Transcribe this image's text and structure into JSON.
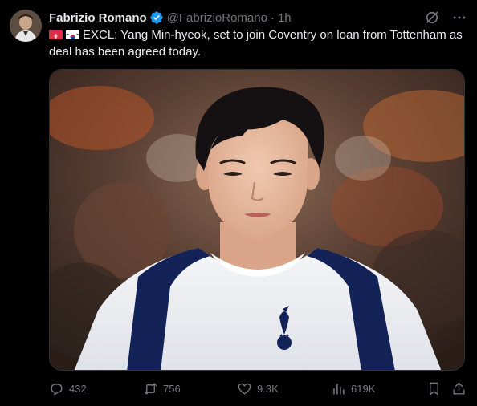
{
  "tweet": {
    "author_name": "Fabrizio Romano",
    "handle": "@FabrizioRomano",
    "separator": "·",
    "time": "1h",
    "text": "EXCL: Yang Min-hyeok, set to join Coventry on loan from Tottenham as deal has been agreed today."
  },
  "icons": {
    "verified": "verified-badge-icon",
    "grok": "grok-icon",
    "more": "more-icon",
    "flag_one": "red-flag-emoji-icon",
    "flag_two": "south-korea-flag-icon"
  },
  "actions": {
    "replies": "432",
    "reposts": "756",
    "likes": "9.3K",
    "views": "619K"
  },
  "colors": {
    "background": "#000000",
    "text": "#e7e9ea",
    "muted": "#71767b",
    "verified": "#1d9bf0"
  }
}
